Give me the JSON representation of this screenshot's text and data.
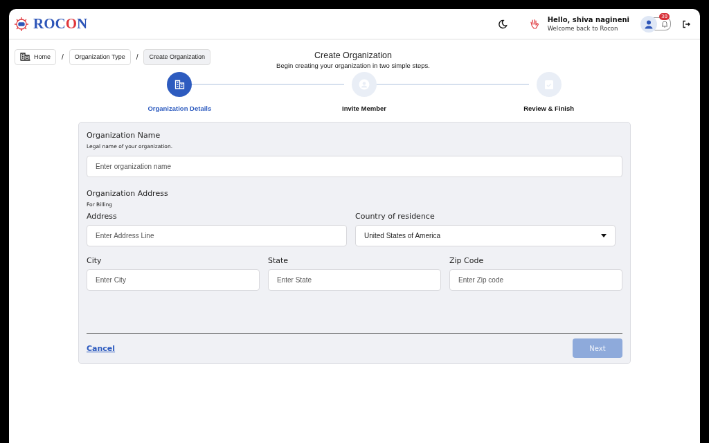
{
  "header": {
    "logo": "ROCON",
    "greeting": "Hello, shiva nagineni",
    "subgreeting": "Welcome back to Rocon",
    "notification_count": "30"
  },
  "breadcrumbs": {
    "items": [
      {
        "label": "Home",
        "selected": false
      },
      {
        "label": "Organization Type",
        "selected": false
      },
      {
        "label": "Create Organization",
        "selected": true
      }
    ],
    "separator": "/"
  },
  "page": {
    "title": "Create Organization",
    "subtitle": "Begin creating your organization in two simple steps."
  },
  "steps": [
    {
      "label": "Organization Details",
      "selected": true,
      "kind": "building"
    },
    {
      "label": "Invite Member",
      "selected": false,
      "kind": "person"
    },
    {
      "label": "Review & Finish",
      "selected": false,
      "kind": "clipboard"
    }
  ],
  "form": {
    "name_label": "Organization Name",
    "name_hint": "Legal name of your organization.",
    "name_placeholder": "Enter organization name",
    "address_heading": "Organization Address",
    "address_hint": "For Billing",
    "rows": [
      [
        {
          "label": "Address",
          "placeholder": "Enter Address Line",
          "kind": "text"
        },
        {
          "label": "Country of residence",
          "value": "United States of America",
          "kind": "select"
        }
      ],
      [
        {
          "label": "City",
          "placeholder": "Enter City",
          "kind": "text"
        },
        {
          "label": "State",
          "placeholder": "Enter State",
          "kind": "text"
        },
        {
          "label": "Zip Code",
          "placeholder": "Enter Zip code",
          "kind": "text"
        }
      ]
    ],
    "cancel": "Cancel",
    "next": {
      "label": "Next",
      "disabled": true
    }
  }
}
